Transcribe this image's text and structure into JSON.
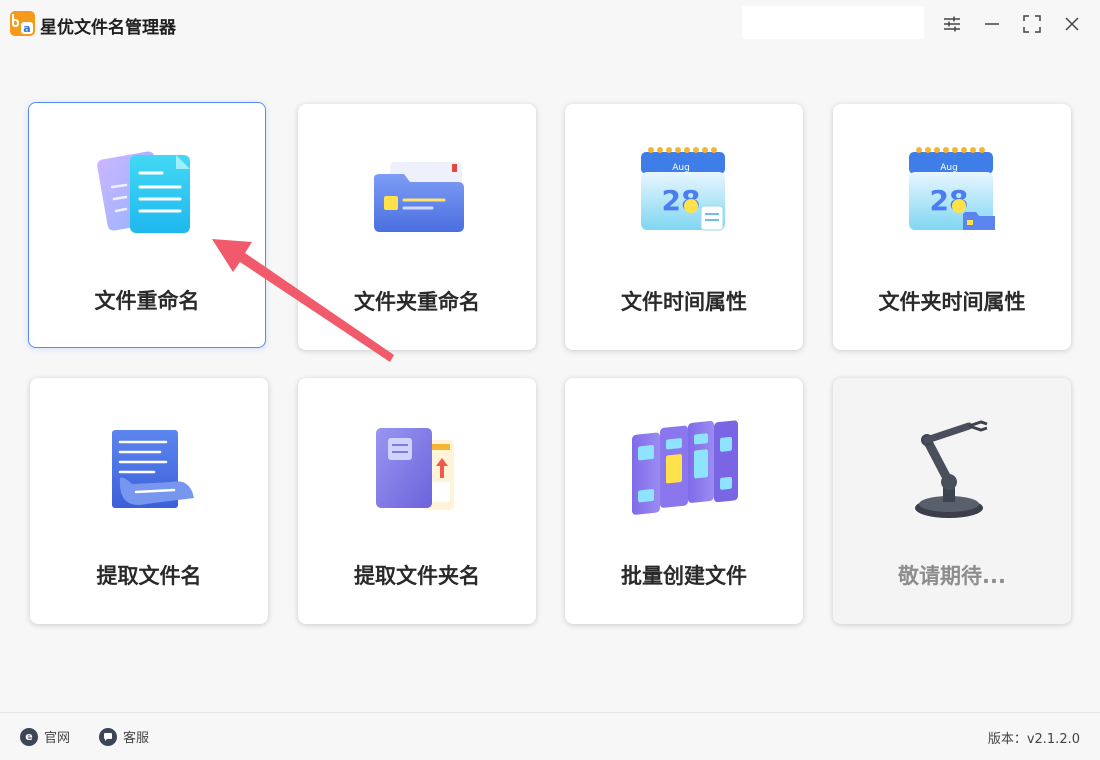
{
  "app": {
    "title": "星优文件名管理器"
  },
  "cards": [
    {
      "label": "文件重命名"
    },
    {
      "label": "文件夹重命名"
    },
    {
      "label": "文件时间属性"
    },
    {
      "label": "文件夹时间属性"
    },
    {
      "label": "提取文件名"
    },
    {
      "label": "提取文件夹名"
    },
    {
      "label": "批量创建文件"
    },
    {
      "label": "敬请期待..."
    }
  ],
  "calendar": {
    "month": "Aug",
    "day": "28"
  },
  "footer": {
    "website": "官网",
    "support": "客服",
    "version": "版本：v2.1.2.0"
  },
  "colors": {
    "accent": "#5a8df0",
    "arrow": "#f05a6a",
    "logo": "#f59a1b"
  },
  "icons": {
    "settings": "sliders-icon",
    "minimize": "minimize-icon",
    "maximize": "maximize-icon",
    "close": "close-icon"
  }
}
